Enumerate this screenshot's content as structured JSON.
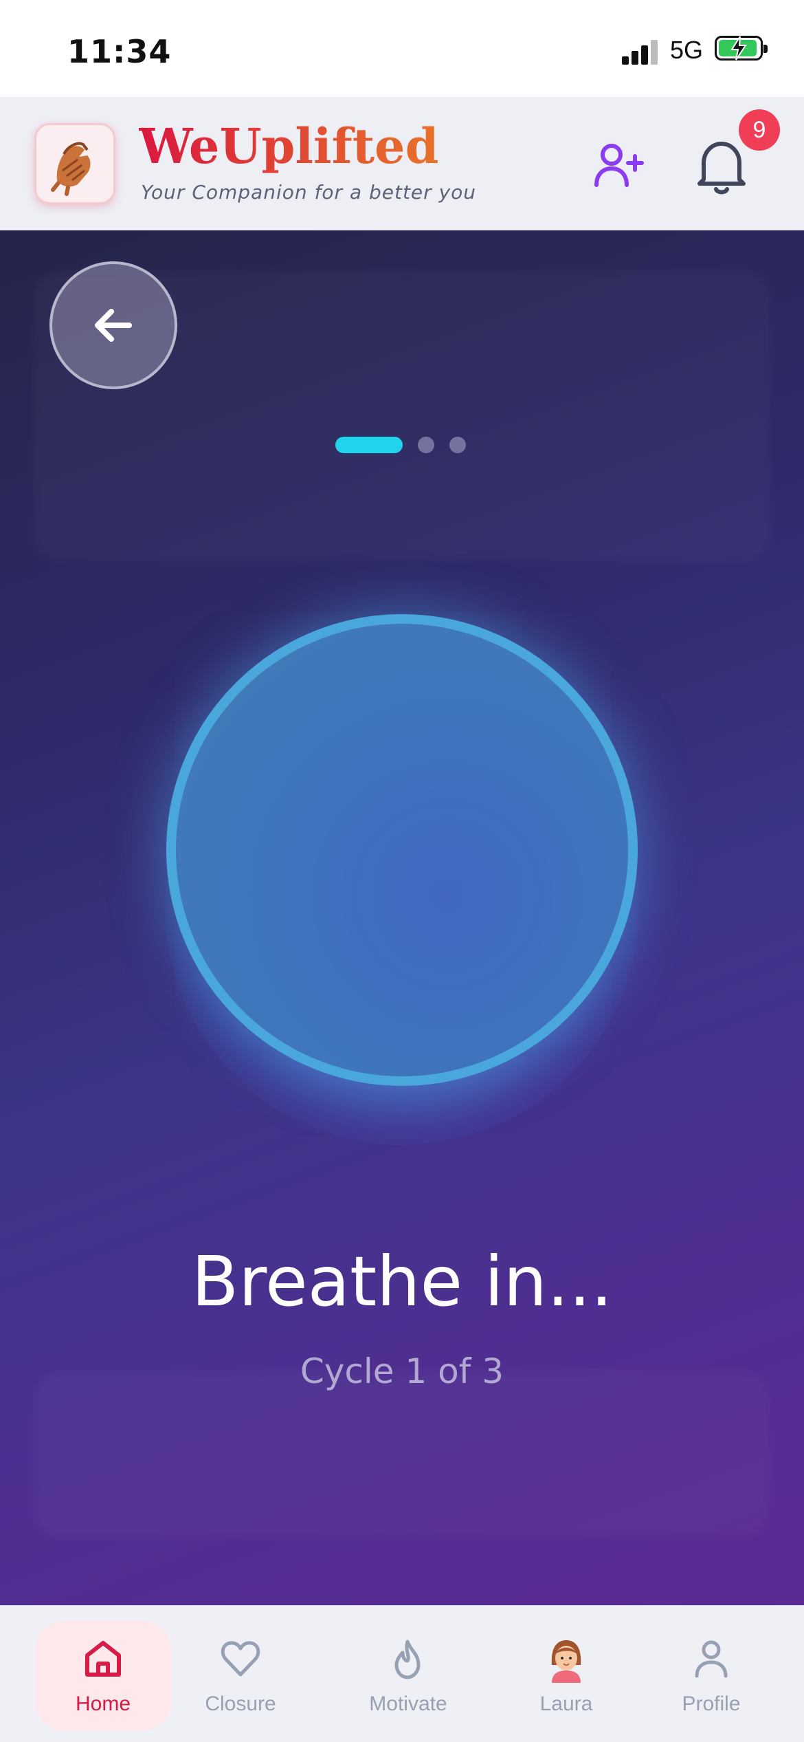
{
  "status_bar": {
    "time": "11:34",
    "network": "5G"
  },
  "header": {
    "brand": "WeUplifted",
    "tagline": "Your Companion for a better you",
    "notification_count": "9",
    "icons": {
      "logo": "handshake-logo",
      "add_user": "user-plus-icon",
      "notifications": "bell-icon"
    }
  },
  "exercise": {
    "back_icon": "arrow-left-icon",
    "step_total": 3,
    "step_current": 1,
    "instruction": "Breathe in...",
    "cycle_label": "Cycle 1 of 3"
  },
  "tabs": [
    {
      "label": "Home",
      "icon": "home-icon",
      "active": true
    },
    {
      "label": "Closure",
      "icon": "heart-icon",
      "active": false
    },
    {
      "label": "Motivate",
      "icon": "flame-icon",
      "active": false
    },
    {
      "label": "Laura",
      "icon": "avatar-icon",
      "active": false
    },
    {
      "label": "Profile",
      "icon": "user-icon",
      "active": false
    }
  ],
  "colors": {
    "accent": "#22d3ee",
    "brand_red": "#d9173f",
    "brand_orange": "#e8732a",
    "active_tab": "#d81b45",
    "circle_ring": "#4aa7dc"
  }
}
